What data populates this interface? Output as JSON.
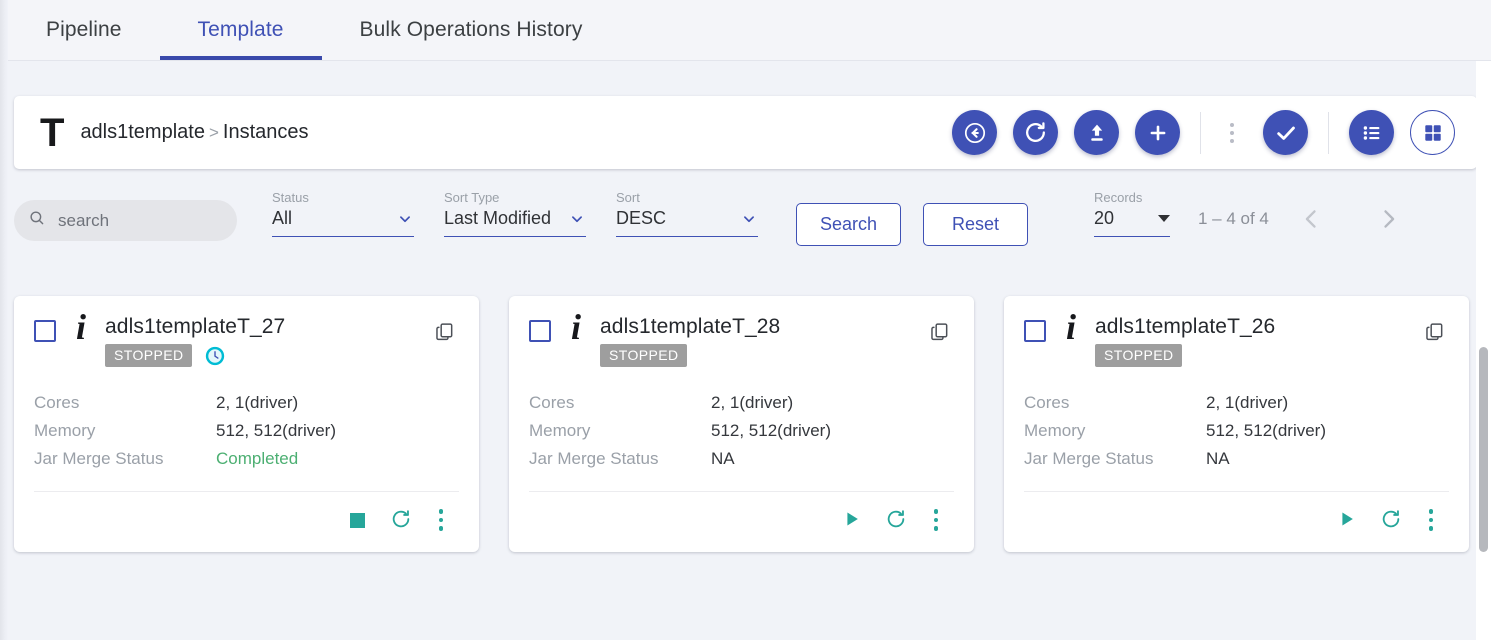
{
  "tabs": [
    {
      "label": "Pipeline",
      "active": false
    },
    {
      "label": "Template",
      "active": true
    },
    {
      "label": "Bulk Operations History",
      "active": false
    }
  ],
  "header": {
    "logo_letter": "T",
    "breadcrumb_root": "adls1template",
    "breadcrumb_separator": ">",
    "breadcrumb_leaf": "Instances",
    "actions": [
      {
        "name": "back-button",
        "icon": "back-arrow-circle-icon"
      },
      {
        "name": "refresh-button",
        "icon": "refresh-icon"
      },
      {
        "name": "upload-button",
        "icon": "upload-icon"
      },
      {
        "name": "add-button",
        "icon": "plus-icon"
      },
      {
        "name": "more-options-button",
        "icon": "kebab-icon"
      },
      {
        "name": "confirm-button",
        "icon": "check-icon"
      },
      {
        "name": "list-view-button",
        "icon": "list-view-icon"
      },
      {
        "name": "grid-view-button",
        "icon": "grid-view-icon"
      }
    ]
  },
  "filters": {
    "search_placeholder": "search",
    "search_value": "",
    "status": {
      "label": "Status",
      "value": "All"
    },
    "sort_type": {
      "label": "Sort Type",
      "value": "Last Modified"
    },
    "sort": {
      "label": "Sort",
      "value": "DESC"
    },
    "search_button": "Search",
    "reset_button": "Reset",
    "records": {
      "label": "Records",
      "value": "20"
    },
    "range_text": "1 – 4 of 4"
  },
  "labels": {
    "cores": "Cores",
    "memory": "Memory",
    "jar_merge_status": "Jar Merge Status"
  },
  "cards": [
    {
      "title": "adls1templateT_27",
      "status": "STOPPED",
      "has_schedule": true,
      "cores": "2, 1(driver)",
      "memory": "512, 512(driver)",
      "jar_merge_status": "Completed",
      "jar_merge_ok": true,
      "primary_action": "stop"
    },
    {
      "title": "adls1templateT_28",
      "status": "STOPPED",
      "has_schedule": false,
      "cores": "2, 1(driver)",
      "memory": "512, 512(driver)",
      "jar_merge_status": "NA",
      "jar_merge_ok": false,
      "primary_action": "start"
    },
    {
      "title": "adls1templateT_26",
      "status": "STOPPED",
      "has_schedule": false,
      "cores": "2, 1(driver)",
      "memory": "512, 512(driver)",
      "jar_merge_status": "NA",
      "jar_merge_ok": false,
      "primary_action": "start"
    }
  ],
  "colors": {
    "accent": "#3f51b5",
    "teal": "#26a69a",
    "badge_gray": "#9e9e9e",
    "success_green": "#4caf72",
    "page_bg": "#f1f3f8"
  }
}
